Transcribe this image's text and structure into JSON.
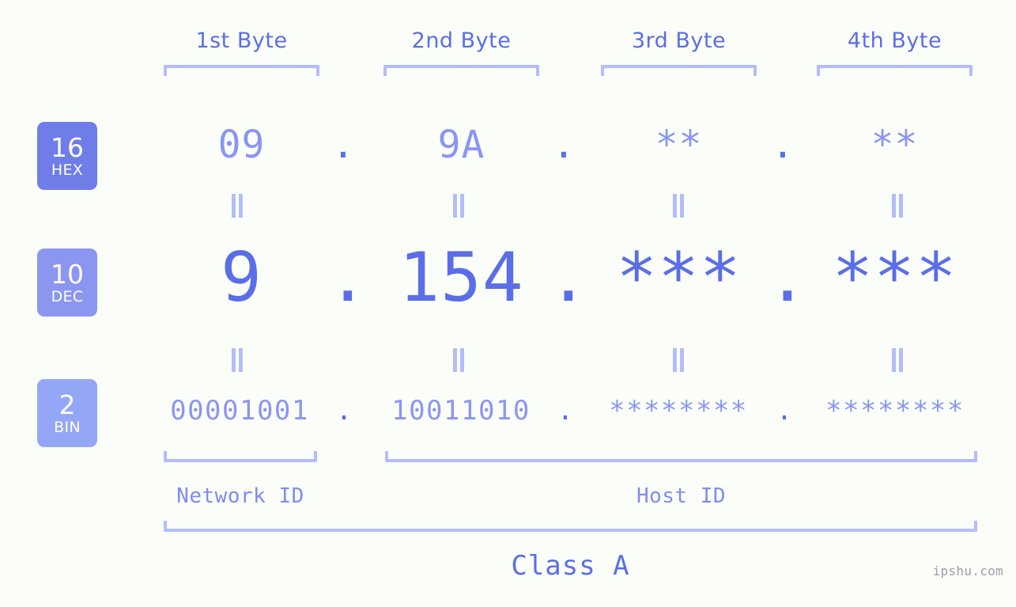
{
  "meta": {
    "background_color": "#fbfdf8",
    "accent_color": "#5a6ee8",
    "accent_light_color": "#8a96f2",
    "bracket_color": "#b3bdfb"
  },
  "byte_headers": [
    {
      "label": "1st Byte"
    },
    {
      "label": "2nd Byte"
    },
    {
      "label": "3rd Byte"
    },
    {
      "label": "4th Byte"
    }
  ],
  "rows": [
    {
      "key": "hex",
      "badge": {
        "number": "16",
        "word": "HEX",
        "color": "#6f7de9"
      },
      "separator": ".",
      "values": [
        "09",
        "9A",
        "**",
        "**"
      ]
    },
    {
      "key": "dec",
      "badge": {
        "number": "10",
        "word": "DEC",
        "color": "#8b96f0"
      },
      "separator": ".",
      "values": [
        "9",
        "154",
        "***",
        "***"
      ]
    },
    {
      "key": "bin",
      "badge": {
        "number": "2",
        "word": "BIN",
        "color": "#94a7f6"
      },
      "separator": ".",
      "values": [
        "00001001",
        "10011010",
        "********",
        "********"
      ]
    }
  ],
  "equals_marks": {
    "glyph": "equals-rotated",
    "count_per_gap": 4,
    "gaps": 2
  },
  "footer": {
    "network_id_label": "Network ID",
    "host_id_label": "Host ID",
    "class_label": "Class A"
  },
  "watermark": {
    "text": "ipshu.com"
  }
}
